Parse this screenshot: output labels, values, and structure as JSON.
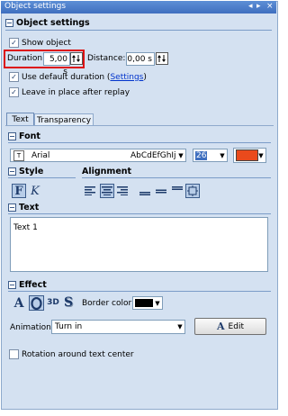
{
  "window": {
    "title": "Object settings",
    "controls": [
      "◂",
      "▸",
      "×"
    ]
  },
  "object_settings": {
    "header": "Object settings",
    "show_object": {
      "label": "Show object",
      "checked": true
    },
    "duration": {
      "label": "Duration:",
      "value": "5,00 s"
    },
    "distance": {
      "label": "Distance:",
      "value": "0,00 s"
    },
    "use_default_duration": {
      "label_prefix": "Use default duration (",
      "link": "Settings",
      "label_suffix": ")",
      "checked": true
    },
    "leave_in_place": {
      "label": "Leave in place after replay",
      "checked": true
    }
  },
  "tabs": [
    {
      "label": "Text",
      "active": true
    },
    {
      "label": "Transparency",
      "active": false
    }
  ],
  "font": {
    "header": "Font",
    "name": "Arial",
    "preview": "AbCdEfGhIj",
    "size": "26",
    "color": "#ea4a1c"
  },
  "style": {
    "header": "Style",
    "bold_glyph": "F",
    "italic_glyph": "K"
  },
  "alignment": {
    "header": "Alignment"
  },
  "text": {
    "header": "Text",
    "value": "Text 1"
  },
  "effect": {
    "header": "Effect",
    "border_color_label": "Border color:",
    "border_color": "#000000",
    "animation_label": "Animation:",
    "animation_value": "Turn in",
    "edit_label": "Edit",
    "effect_3d": "3D",
    "effect_shadow": "S"
  },
  "rotation": {
    "label": "Rotation around text center",
    "checked": false
  }
}
